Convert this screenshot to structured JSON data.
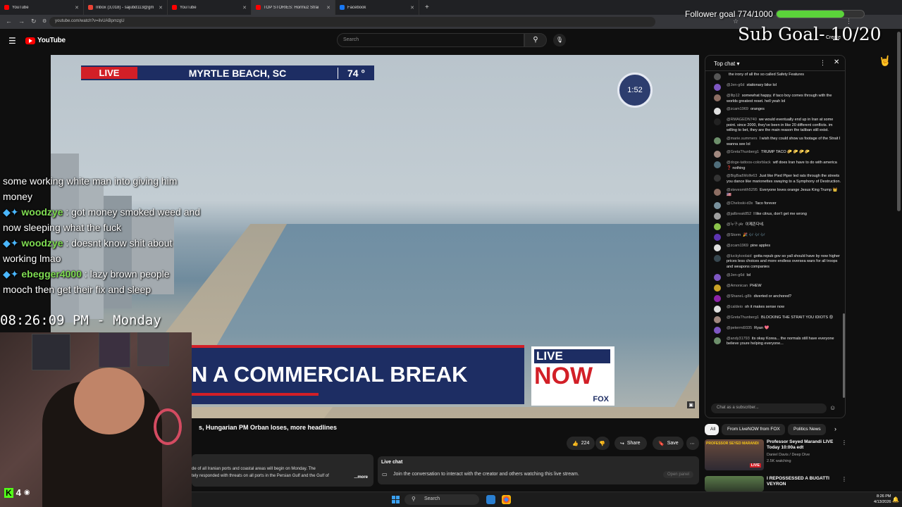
{
  "browser": {
    "tabs": [
      {
        "title": "YouTube",
        "color": "#ff0000",
        "active": false
      },
      {
        "title": "Inbox (3,018) - sajubd113@gm",
        "color": "#ea4335",
        "active": false
      },
      {
        "title": "YouTube",
        "color": "#ff0000",
        "active": false
      },
      {
        "title": "TOP STORIES: Hormuz Strai",
        "color": "#ff0000",
        "active": true
      },
      {
        "title": "Facebook",
        "color": "#1877f2",
        "active": false
      }
    ],
    "url": "youtube.com/watch?v=ilvUABpmzgU"
  },
  "youtube": {
    "logo_text": "YouTube",
    "search_placeholder": "Search",
    "create_label": "Create"
  },
  "overlay": {
    "follower_goal": "Follower goal 774/1000",
    "follower_progress": 0.774,
    "sub_goal": "Sub Goal- 10/20",
    "chat_lines": [
      {
        "user": "",
        "text": "some working white man into giving him money"
      },
      {
        "user": "woodzye",
        "text": ": got money smoked weed and now sleeping what the fuck"
      },
      {
        "user": "woodzye",
        "text": ": doesnt know shit about working lmao"
      },
      {
        "user": "ebegger4000",
        "text": ": lazy brown people mooch then get their fix and sleep"
      }
    ],
    "clock": "08:26:09 PM - Monday",
    "viewer_count": "4"
  },
  "video": {
    "live_badge": "LIVE",
    "location": "MYRTLE BEACH, SC",
    "temperature": "74 °",
    "timer": "1:52",
    "lower_third": "N A COMMERCIAL BREAK",
    "brand_live": "LIVE",
    "brand_now": "NOW",
    "brand_fox": "FOX",
    "title": "s, Hungarian PM Orban loses, more headlines",
    "likes": "224",
    "share_label": "Share",
    "save_label": "Save",
    "description_line1": "de of all Iranian ports and coastal areas will begin on Monday. The",
    "description_line2": "tely responded with threats on all ports in the Persian Gulf and the Gulf of",
    "more_label": "...more"
  },
  "live_chat_box": {
    "heading": "Live chat",
    "body": "Join the conversation to interact with the creator and others watching this live stream.",
    "open_label": "Open panel"
  },
  "chat": {
    "header": "Top chat",
    "input_placeholder": "Chat as a subscriber...",
    "messages": [
      {
        "author": "",
        "text": "the irony of all the so called Safety Features",
        "color": "#555"
      },
      {
        "author": "@Jen-g6d",
        "text": "stationary bike lol",
        "color": "#7e57c2"
      },
      {
        "author": "@lltp12",
        "text": "somewhat happy. if taco boy comes through with the worlds greatest reset. hell yeah lol",
        "color": "#8d6e63"
      },
      {
        "author": "@zcam1969",
        "text": "oranges",
        "color": "#e0e0e0"
      },
      {
        "author": "@RMAGEDN740",
        "text": "we would eventually end up in Iran at some point. since 2000, they've been in like 20 different conflicts. im willing to bet, they are the main reason the taliban still exist.",
        "color": "#222"
      },
      {
        "author": "@marie.summers",
        "text": "I wish they could show us footage of the Strait I wanna see lol",
        "color": "#6d8f6b"
      },
      {
        "author": "@GretaThunberg1",
        "text": "TRUMP TACO 🌮 🌮 🌮 🌮",
        "color": "#a1887f"
      },
      {
        "author": "@doge-tattoos-colorblack",
        "text": "wtf does Iran have to do with america ❓ nothing",
        "color": "#4f6d7a"
      },
      {
        "author": "@BigBadWolfe63",
        "text": "Just like Pied Piper led rats through the streets you dance like marionettes swaying to a Symphony of Destruction.",
        "color": "#333"
      },
      {
        "author": "@stevesmith5295",
        "text": "Everyone loves orange Jesus King Trump 👑 🇺🇸",
        "color": "#8d6e63"
      },
      {
        "author": "@Cheloski-d3x",
        "text": "Taco forever",
        "color": "#78909c"
      },
      {
        "author": "@jailbreak852",
        "text": "I like citrus, don't get me wrong",
        "color": "#9e9e9e"
      },
      {
        "author": "@누구-j4r",
        "text": "이제존다네.",
        "color": "#8bc34a"
      },
      {
        "author": "@Storm",
        "text": "🎉 🎶 🎶 🎶",
        "color": "#5e35b1"
      },
      {
        "author": "@zcam1969",
        "text": "pine apples",
        "color": "#e0e0e0"
      },
      {
        "author": "@luckykoolaid",
        "text": "gotta repub gov so yall should have by now higher prices less choices and more endless oversea wars for all troops and weapons companies",
        "color": "#37474f"
      },
      {
        "author": "@Jen-g6d",
        "text": "lol",
        "color": "#7e57c2"
      },
      {
        "author": "@Amonican",
        "text": "PHEW",
        "color": "#c9a227"
      },
      {
        "author": "@ShaneL-g8b",
        "text": "diverted or anchored?",
        "color": "#8e24aa"
      },
      {
        "author": "@caldeio",
        "text": "oh it makes sense now",
        "color": "#e0e0e0"
      },
      {
        "author": "@GretaThunberg1",
        "text": "BLOCKING THE STRAIT YOU IDIOTS 😡",
        "color": "#a1887f"
      },
      {
        "author": "@petermi9335",
        "text": "Ryan 💖",
        "color": "#7e57c2"
      },
      {
        "author": "@andy31793",
        "text": "its okay Korea... the normals still have everyone believe youre helping everyone...",
        "color": "#6d8f6b"
      }
    ]
  },
  "chips": [
    "All",
    "From LiveNOW from FOX",
    "Politics News"
  ],
  "recommended": [
    {
      "title": "Professor Seyed Marandi LIVE Today 10:00a edt",
      "channel": "Daniel Davis / Deep Dive",
      "meta": "2.5K watching",
      "badge": "LIVE",
      "thumb_label": "PROFESSOR SEYED MARANDI"
    },
    {
      "title": "I REPOSSESSED A BUGATTI VEYRON",
      "channel": "",
      "meta": "",
      "badge": "",
      "thumb_label": ""
    }
  ],
  "taskbar": {
    "search_label": "Search",
    "time": "8:26 PM",
    "date": "4/13/2026"
  }
}
